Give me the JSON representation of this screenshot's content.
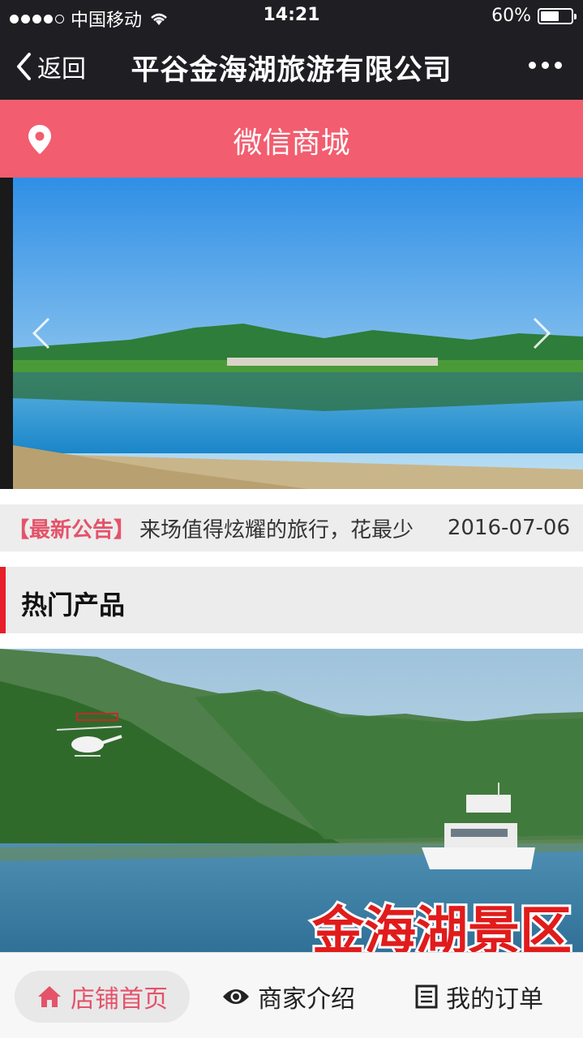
{
  "status_bar": {
    "carrier": "中国移动",
    "time": "14:21",
    "battery": "60%",
    "battery_level": 0.6
  },
  "nav": {
    "back_label": "返回",
    "title": "平谷金海湖旅游有限公司"
  },
  "shop_header": {
    "title": "微信商城"
  },
  "notice": {
    "tag": "【最新公告】",
    "text": "来场值得炫耀的旅行，花最少",
    "date": "2016-07-06"
  },
  "section": {
    "title": "热门产品"
  },
  "product": {
    "overlay_text": "金海湖景区"
  },
  "tabbar": {
    "home": "店铺首页",
    "about": "商家介绍",
    "orders": "我的订单"
  },
  "colors": {
    "accent": "#f25d6f",
    "nav_bg": "#1f1f23",
    "section_bar": "#e81e2a",
    "tag_text": "#e4536a"
  }
}
